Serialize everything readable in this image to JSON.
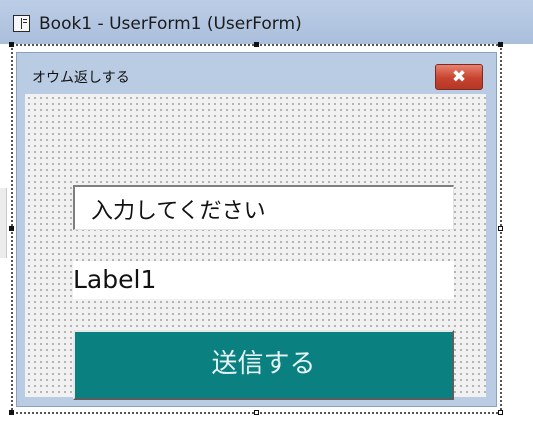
{
  "window": {
    "title": "Book1 - UserForm1 (UserForm)",
    "icon": "userform-designer-icon"
  },
  "userform": {
    "caption": "オウム返しする",
    "close_glyph": "✖",
    "textbox": {
      "value": "入力してください"
    },
    "label": {
      "text": "Label1"
    },
    "button": {
      "label": "送信する",
      "background_color": "#0a8080"
    }
  },
  "colors": {
    "titlebar": "#aabfdc",
    "form_frame": "#b9cce4",
    "close_button": "#c6432f"
  }
}
